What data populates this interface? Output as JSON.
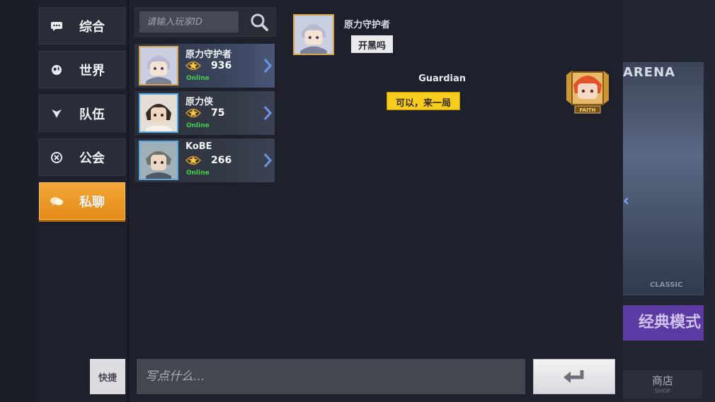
{
  "background": {
    "arena_title": "ARENA",
    "classic_label": "CLASSIC",
    "mode_label": "经典模式",
    "shop_label": "商店",
    "shop_sub": "SHOP"
  },
  "tabs": [
    {
      "label": "综合",
      "icon": "chat-bubble-icon",
      "active": false
    },
    {
      "label": "世界",
      "icon": "globe-icon",
      "active": false
    },
    {
      "label": "队伍",
      "icon": "team-flag-icon",
      "active": false
    },
    {
      "label": "公会",
      "icon": "guild-emblem-icon",
      "active": false
    },
    {
      "label": "私聊",
      "icon": "private-chat-icon",
      "active": true
    }
  ],
  "search": {
    "placeholder": "请输入玩家ID"
  },
  "friends": [
    {
      "name": "原力守护者",
      "score": "936",
      "status": "Online",
      "selected": true
    },
    {
      "name": "原力侠",
      "score": "75",
      "status": "Online",
      "selected": false
    },
    {
      "name": "KoBE",
      "score": "266",
      "status": "Online",
      "selected": false
    }
  ],
  "messages": [
    {
      "sender": "原力守护者",
      "text": "开黑吗",
      "side": "left"
    },
    {
      "sender": "Guardian",
      "text": "可以，来一局",
      "side": "right",
      "badge": "FAITH"
    }
  ],
  "input": {
    "quick_label": "快捷",
    "placeholder": "写点什么..."
  },
  "colors": {
    "active_tab": "#e58b18",
    "online": "#43d14b",
    "bubble_right": "#f7cc1f"
  }
}
